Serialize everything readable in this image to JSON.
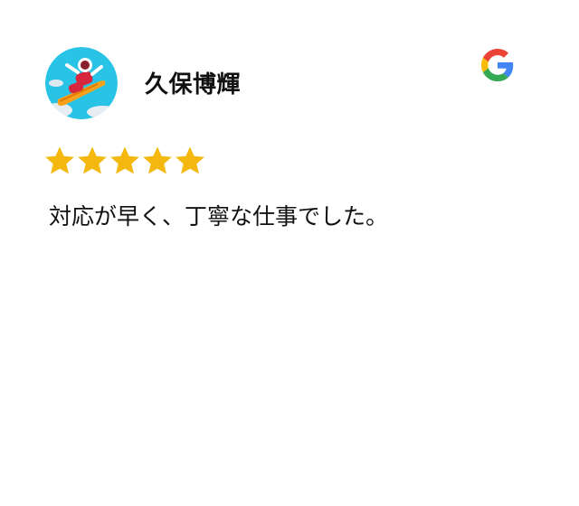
{
  "review": {
    "reviewer_name": "久保博輝",
    "avatar_icon": "snowboarder-avatar-icon",
    "source_icon": "google-g-logo-icon",
    "rating": 5,
    "rating_max": 5,
    "text": "対応が早く、丁寧な仕事でした。"
  },
  "colors": {
    "star": "#F5B80F",
    "avatar_bg": "#29C3E6",
    "google_blue": "#4285F4",
    "google_red": "#EA4335",
    "google_yellow": "#FBBC05",
    "google_green": "#34A853"
  }
}
